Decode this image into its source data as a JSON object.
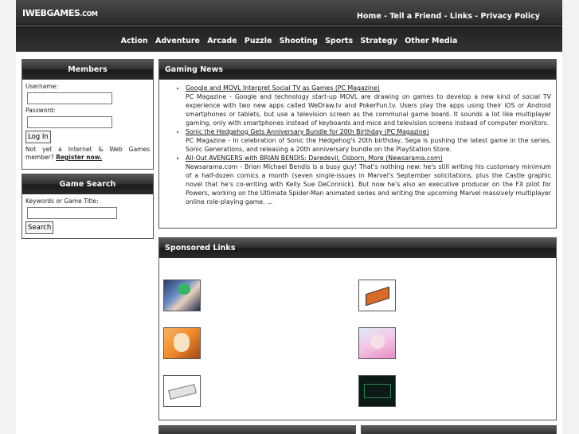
{
  "site": {
    "logo_main": "IWEBGAMES",
    "logo_suffix": ".COM"
  },
  "top_nav": [
    {
      "label": "Home"
    },
    {
      "label": "Tell a Friend"
    },
    {
      "label": "Links"
    },
    {
      "label": "Privacy Policy"
    }
  ],
  "top_nav_separator": " - ",
  "categories": [
    "Action",
    "Adventure",
    "Arcade",
    "Puzzle",
    "Shooting",
    "Sports",
    "Strategy",
    "Other Media"
  ],
  "members": {
    "title": "Members",
    "username_label": "Username:",
    "password_label": "Password:",
    "login_button": "Log In",
    "register_text": "Not yet a Internet & Web Games member?",
    "register_link": "Register now."
  },
  "game_search": {
    "title": "Game Search",
    "field_label": "Keywords or Game Title:",
    "search_button": "Search"
  },
  "gaming_news": {
    "title": "Gaming News",
    "items": [
      {
        "headline": "Google and MOVL Interpret Social TV as Games (PC Magazine)",
        "body": "PC Magazine - Google and technology start-up MOVL are drawing on games to develop a new kind of social TV experience with two new apps called WeDraw.tv and PokerFun.tv. Users play the apps using their iOS or Android smartphones or tablets, but use a television screen as the communal game board. It sounds a lot like multiplayer gaming, only with smartphones instead of keyboards and mice and television screens instead of computer monitors."
      },
      {
        "headline": "Sonic the Hedgehog Gets Anniversary Bundle for 20th Birthday (PC Magazine)",
        "body": "PC Magazine - In celebration of Sonic the Hedgehog's 20th birthday, Sega is pushing the latest game in the series, Sonic Generations, and releasing a 20th anniversary bundle on the PlayStation Store."
      },
      {
        "headline": "All-Out AVENGERS with BRIAN BENDIS: Daredevil, Osborn, More (Newsarama.com)",
        "body": "Newsarama.com - Brian Michael Bendis is a busy guy! That's nothing new: he's still writing his customary minimum of a half-dozen comics a month (seven single-issues in Marvel's September solicitations, plus the Castle graphic novel that he's co-writing with Kelly Sue DeConnick). But now he's also an executive producer on the FX pilot for Powers, working on the Ultimate Spider-Man animated series and writing the upcoming Marvel massively multiplayer online role-playing game. ..."
      }
    ]
  },
  "sponsored": {
    "title": "Sponsored Links"
  },
  "colors": {
    "header_dark": "#1f1f1f",
    "page_bg": "#f2f2f2"
  }
}
